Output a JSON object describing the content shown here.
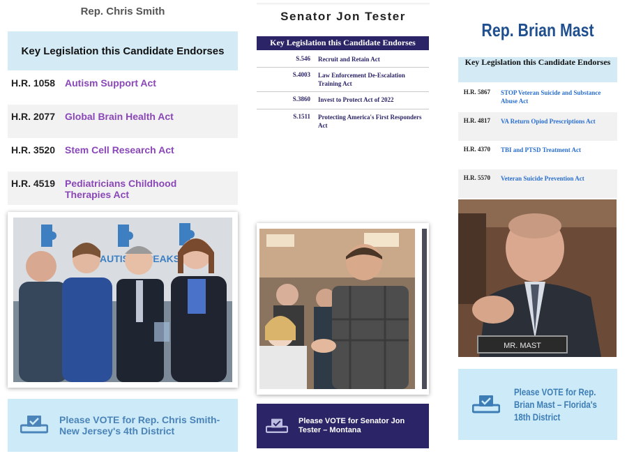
{
  "chris_smith": {
    "name": "Rep. Chris Smith",
    "legislation_header": "Key Legislation this Candidate Endorses",
    "bills": [
      {
        "number": "H.R. 1058",
        "title": "Autism Support Act"
      },
      {
        "number": "H.R. 2077",
        "title": "Global Brain Health Act"
      },
      {
        "number": "H.R. 3520",
        "title": "Stem Cell Research Act"
      },
      {
        "number": "H.R. 4519",
        "title": "Pediatricians Childhood Therapies Act"
      }
    ],
    "photo_sign_text": "AUTISM SPEAKS",
    "vote_text": "Please VOTE for Rep. Chris Smith- New Jersey's 4th District",
    "vote_icon": "ballot-box-check-icon"
  },
  "jon_tester": {
    "name": "Senator Jon Tester",
    "legislation_header": "Key Legislation this Candidate Endorses",
    "bills": [
      {
        "number": "S.546",
        "title": "Recruit and Retain Act"
      },
      {
        "number": "S.4003",
        "title": "Law Enforcement De-Escalation Training Act"
      },
      {
        "number": "S.3860",
        "title": "Invest to Protect Act of 2022"
      },
      {
        "number": "S.1511",
        "title": "Protecting America's First Responders Act"
      }
    ],
    "vote_text": "Please VOTE for Senator Jon Tester – Montana",
    "vote_icon": "ballot-box-check-icon"
  },
  "brian_mast": {
    "name": "Rep. Brian Mast",
    "legislation_header": "Key Legislation this Candidate Endorses",
    "bills": [
      {
        "number": "H.R. 5867",
        "title": "STOP Veteran Suicide and Substance Abuse Act"
      },
      {
        "number": "H.R. 4817",
        "title": "VA Return Opiod Prescriptions Act"
      },
      {
        "number": "H.R. 4370",
        "title": "TBI and PTSD Treatment Act"
      },
      {
        "number": "H.R. 5570",
        "title": "Veteran Suicide Prevention Act"
      }
    ],
    "nameplate_text": "MR. MAST",
    "vote_text": "Please VOTE for Rep. Brian Mast – Florida's 18th District",
    "vote_icon": "ballot-box-check-icon"
  },
  "colors": {
    "light_blue_panel": "#cdeaf8",
    "smith_link": "#8a47b8",
    "tester_navy": "#2b2567",
    "mast_title": "#1f4f8f",
    "mast_link": "#2a6fd1"
  }
}
